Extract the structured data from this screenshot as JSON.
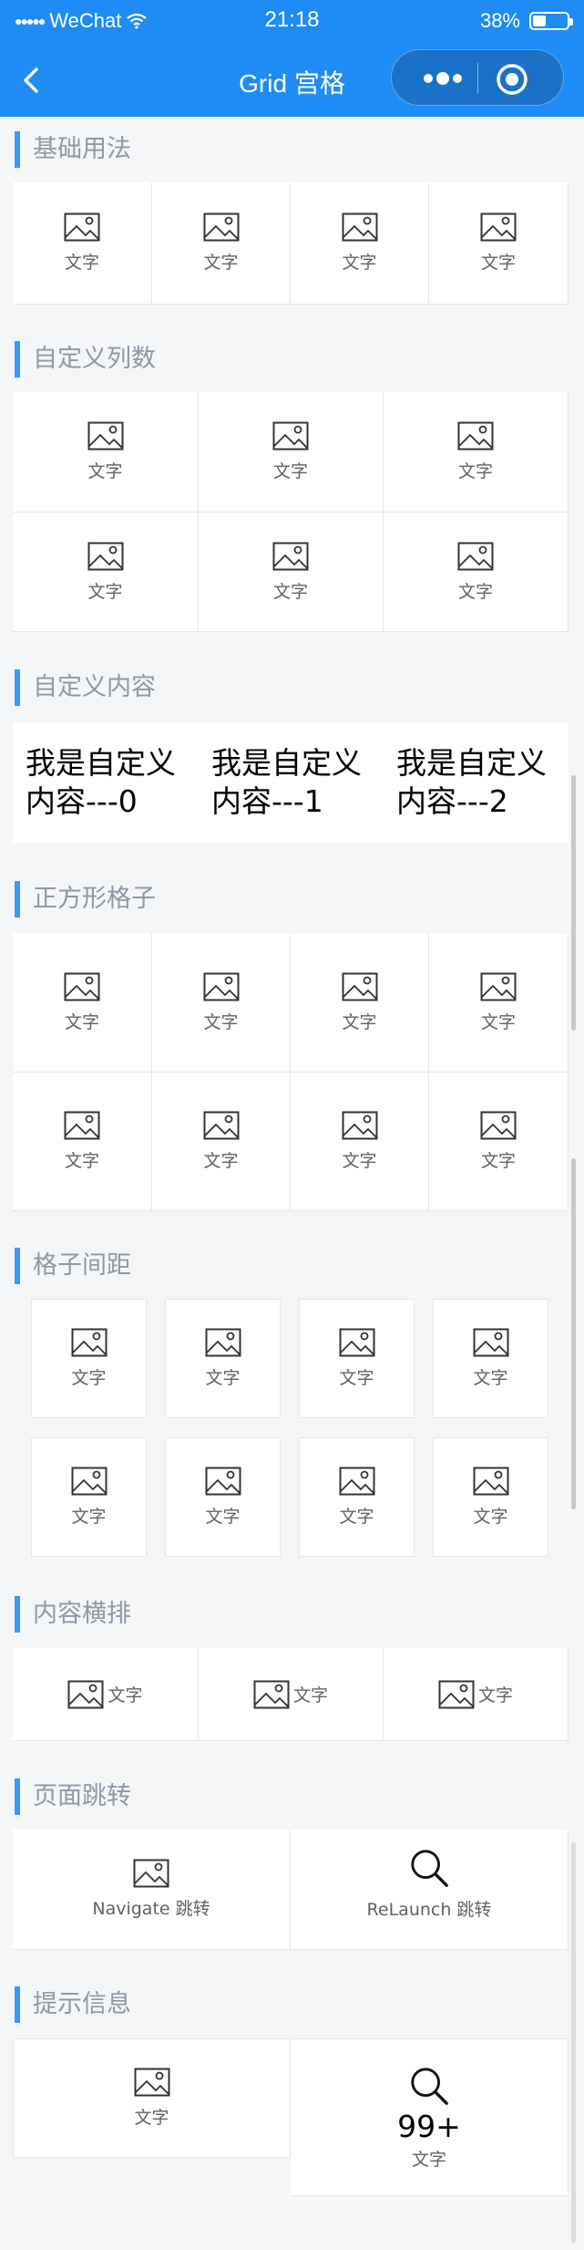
{
  "status_bar": {
    "signal": "●●●●●",
    "carrier": "WeChat",
    "time": "21:18",
    "battery": "38%",
    "battery_level": 0.38
  },
  "nav": {
    "title": "Grid 宫格"
  },
  "sections": {
    "basic": {
      "title": "基础用法",
      "items": [
        "文字",
        "文字",
        "文字",
        "文字"
      ]
    },
    "columns": {
      "title": "自定义列数",
      "items": [
        "文字",
        "文字",
        "文字",
        "文字",
        "文字",
        "文字"
      ]
    },
    "custom": {
      "title": "自定义内容",
      "items": [
        "我是自定义内容---0",
        "我是自定义内容---1",
        "我是自定义内容---2"
      ]
    },
    "square": {
      "title": "正方形格子",
      "items": [
        "文字",
        "文字",
        "文字",
        "文字",
        "文字",
        "文字",
        "文字",
        "文字"
      ]
    },
    "gutter": {
      "title": "格子间距",
      "items": [
        "文字",
        "文字",
        "文字",
        "文字",
        "文字",
        "文字",
        "文字",
        "文字"
      ]
    },
    "horizontal": {
      "title": "内容横排",
      "items": [
        "文字",
        "文字",
        "文字"
      ]
    },
    "navigate": {
      "title": "页面跳转",
      "items": [
        "Navigate 跳转",
        "ReLaunch 跳转"
      ]
    },
    "badge": {
      "title": "提示信息",
      "items": [
        "文字",
        "文字"
      ],
      "badge": "99+"
    }
  },
  "colors": {
    "accent": "#1f8cf5",
    "section_bar": "#3b98f4",
    "background": "#f5f6f8"
  }
}
